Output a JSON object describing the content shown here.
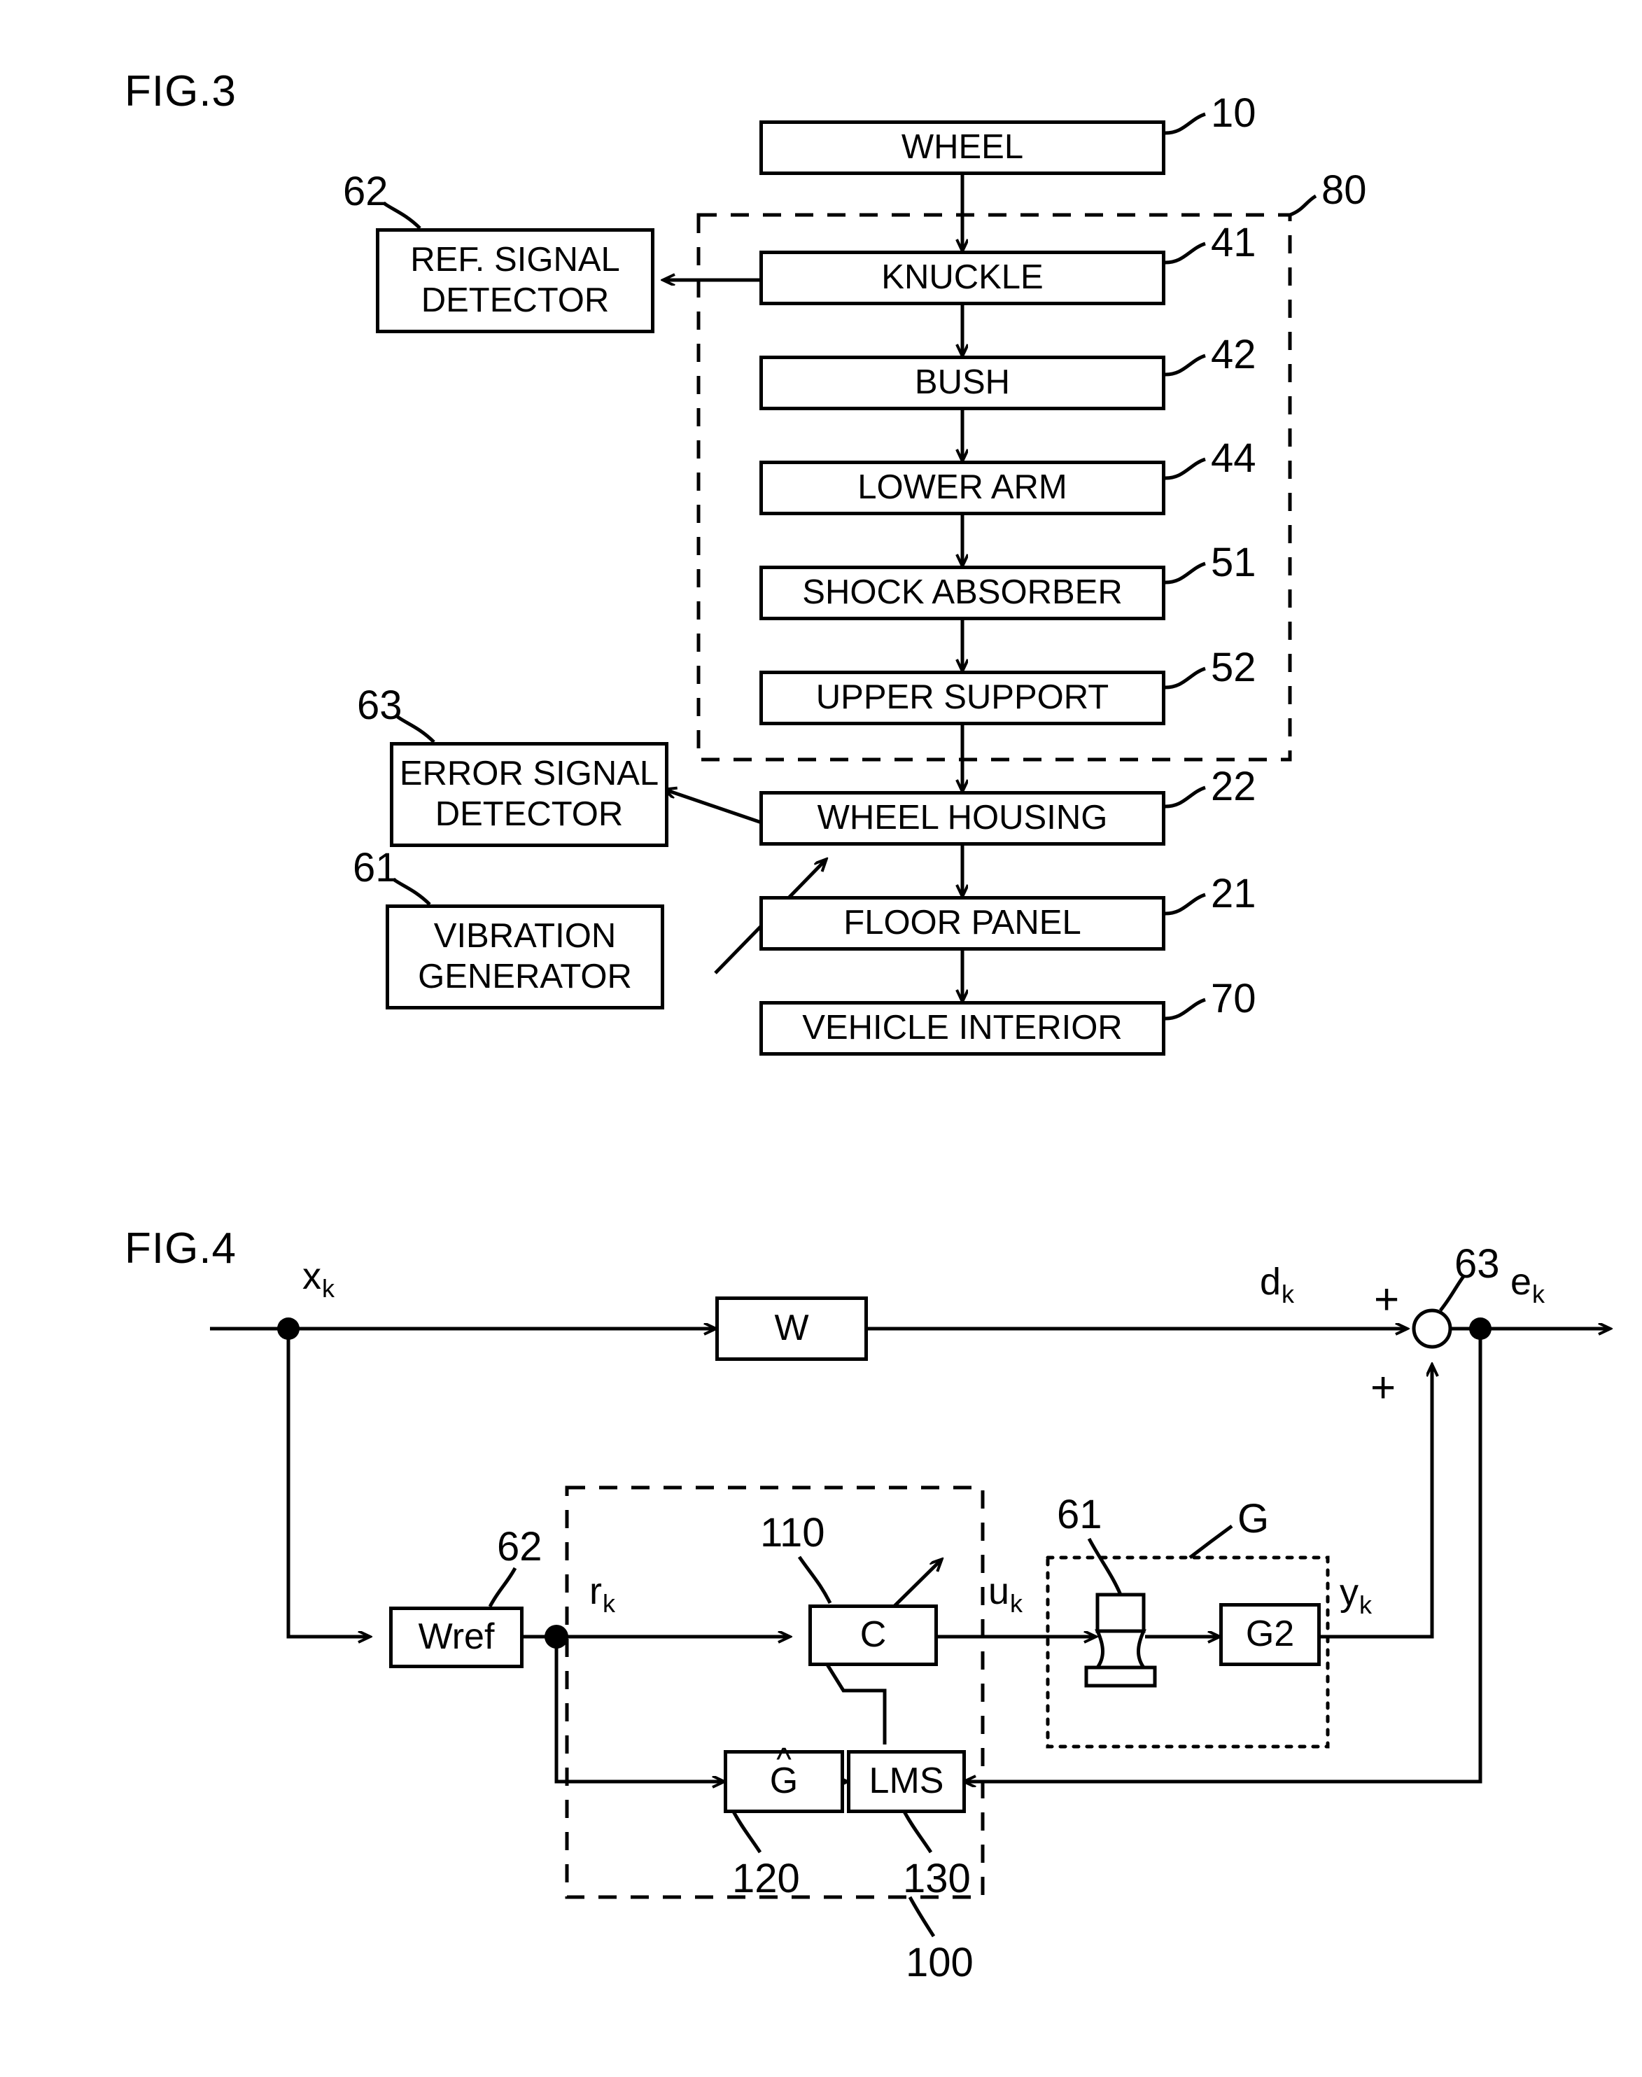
{
  "figures": {
    "fig3": {
      "label": "FIG.3",
      "boxes": [
        {
          "id": "wheel",
          "lines": [
            "WHEEL"
          ],
          "ref": "10"
        },
        {
          "id": "knuckle",
          "lines": [
            "KNUCKLE"
          ],
          "ref": "41"
        },
        {
          "id": "bush",
          "lines": [
            "BUSH"
          ],
          "ref": "42"
        },
        {
          "id": "lower-arm",
          "lines": [
            "LOWER ARM"
          ],
          "ref": "44"
        },
        {
          "id": "shock-absorber",
          "lines": [
            "SHOCK ABSORBER"
          ],
          "ref": "51"
        },
        {
          "id": "upper-support",
          "lines": [
            "UPPER SUPPORT"
          ],
          "ref": "52"
        },
        {
          "id": "wheel-housing",
          "lines": [
            "WHEEL HOUSING"
          ],
          "ref": "22"
        },
        {
          "id": "floor-panel",
          "lines": [
            "FLOOR PANEL"
          ],
          "ref": "21"
        },
        {
          "id": "vehicle-interior",
          "lines": [
            "VEHICLE INTERIOR"
          ],
          "ref": "70"
        },
        {
          "id": "ref-signal-detector",
          "lines": [
            "REF. SIGNAL",
            "DETECTOR"
          ],
          "ref": "62"
        },
        {
          "id": "error-signal-detector",
          "lines": [
            "ERROR SIGNAL",
            "DETECTOR"
          ],
          "ref": "63"
        },
        {
          "id": "vibration-generator",
          "lines": [
            "VIBRATION",
            "GENERATOR"
          ],
          "ref": "61"
        }
      ],
      "suspension_group_ref": "80"
    },
    "fig4": {
      "label": "FIG.4",
      "boxes": [
        {
          "id": "w",
          "label": "W",
          "ref": ""
        },
        {
          "id": "wref",
          "label": "Wref",
          "ref": "62"
        },
        {
          "id": "c",
          "label": "C",
          "ref": "110"
        },
        {
          "id": "ghat",
          "label": "G",
          "hat": "^",
          "ref": "120"
        },
        {
          "id": "lms",
          "label": "LMS",
          "ref": "130"
        },
        {
          "id": "g2",
          "label": "G2",
          "ref": ""
        }
      ],
      "signals": [
        {
          "id": "x",
          "base": "x",
          "sub": "k"
        },
        {
          "id": "d",
          "base": "d",
          "sub": "k"
        },
        {
          "id": "e",
          "base": "e",
          "sub": "k"
        },
        {
          "id": "r",
          "base": "r",
          "sub": "k"
        },
        {
          "id": "u",
          "base": "u",
          "sub": "k"
        },
        {
          "id": "y",
          "base": "y",
          "sub": "k"
        }
      ],
      "summing_junction": {
        "ref": "63",
        "sign_top": "+",
        "sign_bottom": "+"
      },
      "actuator_ref": "61",
      "plant_ref": "G",
      "controller_group_ref": "100"
    }
  },
  "colors": {
    "line": "#000000",
    "background": "#ffffff"
  }
}
